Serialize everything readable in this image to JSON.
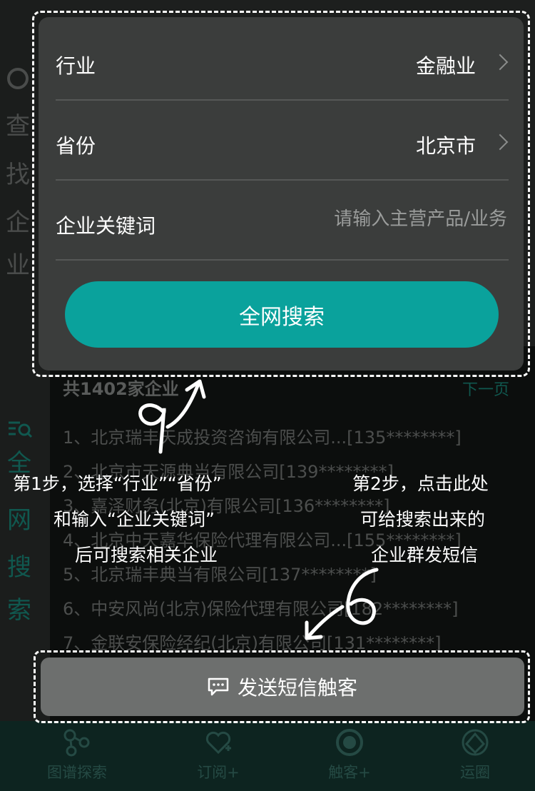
{
  "background": {
    "side_tab_search_chars": [
      "查",
      "找",
      "企",
      "业"
    ],
    "side_tab_net_chars": [
      "全",
      "网",
      "搜",
      "索"
    ],
    "list_header": "共1402家企业",
    "next_page": "下一页",
    "rows": [
      "1、北京瑞丰天成投资咨询有限公司...[135********]",
      "2、北京市天源典当有限公司[139********]",
      "3、嘉泽财务(北京)有限公司[136********]",
      "4、北京中天嘉华保险代理有限公司...[155********]",
      "5、北京瑞丰典当有限公司[137********]",
      "6、中安风尚(北京)保险代理有限公司[182********]",
      "7、金联安保险经纪(北京)有限公司[131********]"
    ]
  },
  "form": {
    "industry_label": "行业",
    "industry_value": "金融业",
    "province_label": "省份",
    "province_value": "北京市",
    "keyword_label": "企业关键词",
    "keyword_value": "",
    "keyword_placeholder": "请输入主营产品/业务",
    "search_button": "全网搜索"
  },
  "annotations": {
    "step1_line1": "第1步，选择“行业”“省份”",
    "step1_line2": "和输入“企业关键词”",
    "step1_line3": "后可搜索相关企业",
    "step2_line1": "第2步，点击此处",
    "step2_line2": "可给搜索出来的",
    "step2_line3": "企业群发短信"
  },
  "send_button": {
    "label": "发送短信触客",
    "icon": "chat-bubble-icon"
  },
  "tabbar": {
    "items": [
      {
        "label": "图谱探索",
        "icon": "graph-icon"
      },
      {
        "label": "订阅+",
        "icon": "heart-plus-icon"
      },
      {
        "label": "触客+",
        "icon": "target-icon"
      },
      {
        "label": "运圈",
        "icon": "circle-icon"
      }
    ]
  },
  "colors": {
    "accent": "#0aa29c",
    "panel": "#3b3d3c",
    "send_button": "#6d6f6e"
  }
}
